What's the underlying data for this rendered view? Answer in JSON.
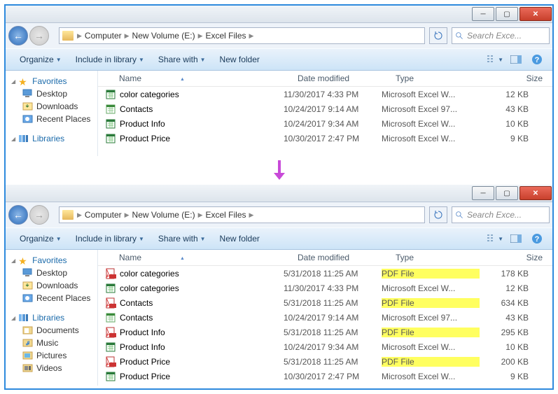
{
  "toolbar": {
    "organize": "Organize",
    "include": "Include in library",
    "share": "Share with",
    "newfolder": "New folder"
  },
  "breadcrumb": [
    "Computer",
    "New Volume (E:)",
    "Excel Files"
  ],
  "searchPlaceholder": "Search Exce...",
  "columns": {
    "name": "Name",
    "date": "Date modified",
    "type": "Type",
    "size": "Size"
  },
  "side": {
    "favorites": "Favorites",
    "desktop": "Desktop",
    "downloads": "Downloads",
    "recent": "Recent Places",
    "libraries": "Libraries",
    "documents": "Documents",
    "music": "Music",
    "pictures": "Pictures",
    "videos": "Videos"
  },
  "win1": {
    "rows": [
      {
        "icon": "xlsx",
        "name": "color categories",
        "date": "11/30/2017 4:33 PM",
        "type": "Microsoft Excel W...",
        "size": "12 KB"
      },
      {
        "icon": "xls",
        "name": "Contacts",
        "date": "10/24/2017 9:14 AM",
        "type": "Microsoft Excel 97...",
        "size": "43 KB"
      },
      {
        "icon": "xlsx",
        "name": "Product Info",
        "date": "10/24/2017 9:34 AM",
        "type": "Microsoft Excel W...",
        "size": "10 KB"
      },
      {
        "icon": "xlsx",
        "name": "Product Price",
        "date": "10/30/2017 2:47 PM",
        "type": "Microsoft Excel W...",
        "size": "9 KB"
      }
    ]
  },
  "win2": {
    "rows": [
      {
        "icon": "pdf",
        "name": "color categories",
        "date": "5/31/2018 11:25 AM",
        "type": "PDF File",
        "size": "178 KB",
        "hl": true
      },
      {
        "icon": "xlsx",
        "name": "color categories",
        "date": "11/30/2017 4:33 PM",
        "type": "Microsoft Excel W...",
        "size": "12 KB"
      },
      {
        "icon": "pdf",
        "name": "Contacts",
        "date": "5/31/2018 11:25 AM",
        "type": "PDF File",
        "size": "634 KB",
        "hl": true
      },
      {
        "icon": "xls",
        "name": "Contacts",
        "date": "10/24/2017 9:14 AM",
        "type": "Microsoft Excel 97...",
        "size": "43 KB"
      },
      {
        "icon": "pdf",
        "name": "Product Info",
        "date": "5/31/2018 11:25 AM",
        "type": "PDF File",
        "size": "295 KB",
        "hl": true
      },
      {
        "icon": "xlsx",
        "name": "Product Info",
        "date": "10/24/2017 9:34 AM",
        "type": "Microsoft Excel W...",
        "size": "10 KB"
      },
      {
        "icon": "pdf",
        "name": "Product Price",
        "date": "5/31/2018 11:25 AM",
        "type": "PDF File",
        "size": "200 KB",
        "hl": true
      },
      {
        "icon": "xlsx",
        "name": "Product Price",
        "date": "10/30/2017 2:47 PM",
        "type": "Microsoft Excel W...",
        "size": "9 KB"
      }
    ]
  }
}
